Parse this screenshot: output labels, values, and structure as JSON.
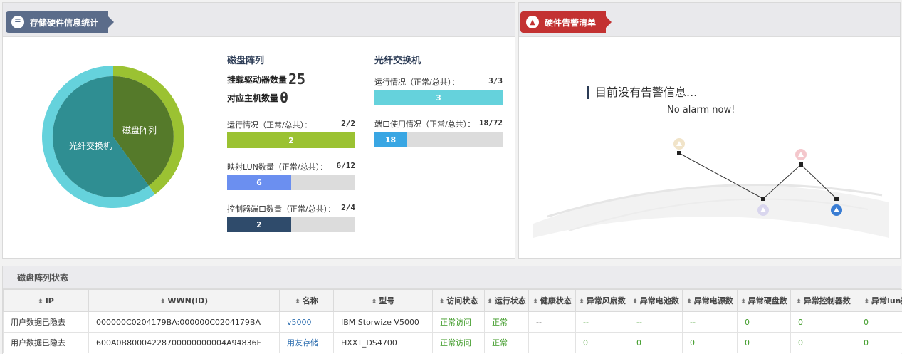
{
  "storage_panel": {
    "title": "存储硬件信息统计",
    "pie_labels": {
      "array": "磁盘阵列",
      "fc": "光纤交换机"
    },
    "disk_array": {
      "heading": "磁盘阵列",
      "drives_label": "挂载驱动器数量",
      "drives_value": "25",
      "hosts_label": "对应主机数量",
      "hosts_value": "0",
      "metrics": [
        {
          "label": "运行情况（正常/总共）：",
          "count": "2/2",
          "bar_text": "2",
          "fraction": 1.0,
          "color": "#9bc232"
        },
        {
          "label": "映射LUN数量（正常/总共）：",
          "count": "6/12",
          "bar_text": "6",
          "fraction": 0.5,
          "color": "#6b8ff0"
        },
        {
          "label": "控制器端口数量（正常/总共）：",
          "count": "2/4",
          "bar_text": "2",
          "fraction": 0.5,
          "color": "#2f4b6b"
        }
      ]
    },
    "fc_switch": {
      "heading": "光纤交换机",
      "metrics": [
        {
          "label": "运行情况（正常/总共）：",
          "count": "3/3",
          "bar_text": "3",
          "fraction": 1.0,
          "color": "#65d2dc"
        },
        {
          "label": "端口使用情况（正常/总共）：",
          "count": "18/72",
          "bar_text": "18",
          "fraction": 0.25,
          "color": "#39a6e3"
        }
      ]
    }
  },
  "alarm_panel": {
    "title": "硬件告警清单",
    "message_cn": "目前没有告警信息...",
    "message_en": "No alarm now!"
  },
  "array_status": {
    "title": "磁盘阵列状态",
    "columns": [
      "IP",
      "WWN(ID)",
      "名称",
      "型号",
      "访问状态",
      "运行状态",
      "健康状态",
      "异常风扇数",
      "异常电池数",
      "异常电源数",
      "异常硬盘数",
      "异常控制器数",
      "异常lun数"
    ],
    "rows": [
      [
        "用户数据已隐去",
        "000000C0204179BA:000000C0204179BA",
        "v5000",
        "IBM Storwize V5000",
        "正常访问",
        "正常",
        "--",
        "--",
        "--",
        "--",
        "0",
        "0",
        "0"
      ],
      [
        "用户数据已隐去",
        "600A0B80004228700000000004A94836F",
        "用友存储",
        "HXXT_DS4700",
        "正常访问",
        "正常",
        "",
        "0",
        "0",
        "0",
        "0",
        "0",
        "0"
      ]
    ]
  },
  "colors": {
    "pie_array": "#557a2a",
    "pie_array_ring": "#9bc232",
    "pie_fc": "#2f8e92",
    "pie_fc_ring": "#65d2dc"
  }
}
